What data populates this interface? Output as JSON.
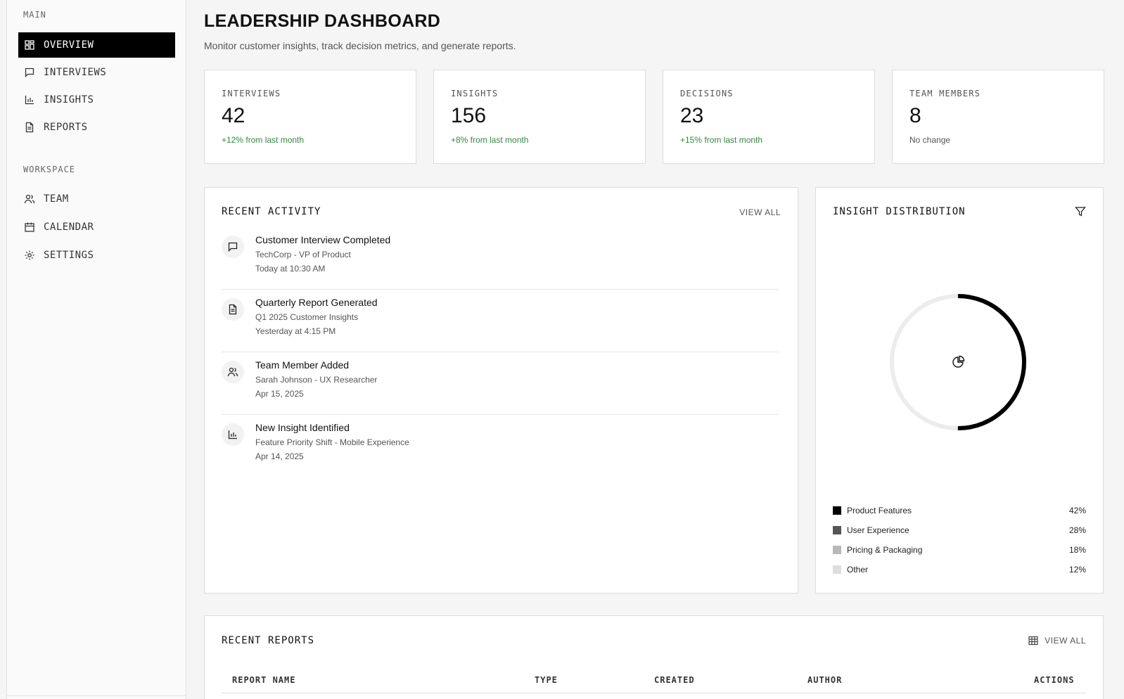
{
  "sidebar": {
    "main_label": "MAIN",
    "workspace_label": "WORKSPACE",
    "main_items": [
      {
        "label": "OVERVIEW",
        "icon": "dashboard-icon",
        "active": true
      },
      {
        "label": "INTERVIEWS",
        "icon": "message-square-icon"
      },
      {
        "label": "INSIGHTS",
        "icon": "bar-chart-icon"
      },
      {
        "label": "REPORTS",
        "icon": "file-text-icon"
      }
    ],
    "workspace_items": [
      {
        "label": "TEAM",
        "icon": "users-icon"
      },
      {
        "label": "CALENDAR",
        "icon": "calendar-icon"
      },
      {
        "label": "SETTINGS",
        "icon": "gear-icon"
      }
    ]
  },
  "header": {
    "title_light": "LEADERSHIP",
    "title_bold": "DASHBOARD",
    "subtitle": "Monitor customer insights, track decision metrics, and generate reports."
  },
  "stats": [
    {
      "label": "INTERVIEWS",
      "value": "42",
      "change": "+12% from last month",
      "positive": true
    },
    {
      "label": "INSIGHTS",
      "value": "156",
      "change": "+8% from last month",
      "positive": true
    },
    {
      "label": "DECISIONS",
      "value": "23",
      "change": "+15% from last month",
      "positive": true
    },
    {
      "label": "TEAM MEMBERS",
      "value": "8",
      "change": "No change",
      "positive": false
    }
  ],
  "activity": {
    "title": "RECENT ACTIVITY",
    "view_all": "VIEW ALL",
    "items": [
      {
        "title": "Customer Interview Completed",
        "subtitle": "TechCorp - VP of Product",
        "time": "Today at 10:30 AM",
        "icon": "message-square-icon"
      },
      {
        "title": "Quarterly Report Generated",
        "subtitle": "Q1 2025 Customer Insights",
        "time": "Yesterday at 4:15 PM",
        "icon": "file-text-icon"
      },
      {
        "title": "Team Member Added",
        "subtitle": "Sarah Johnson - UX Researcher",
        "time": "Apr 15, 2025",
        "icon": "users-icon"
      },
      {
        "title": "New Insight Identified",
        "subtitle": "Feature Priority Shift - Mobile Experience",
        "time": "Apr 14, 2025",
        "icon": "bar-chart-icon"
      }
    ]
  },
  "distribution": {
    "title": "INSIGHT DISTRIBUTION",
    "filter_icon": "filter-icon",
    "center_icon": "pie-chart-icon",
    "progress_fraction": 0.5,
    "legend": [
      {
        "label": "Product Features",
        "pct": "42%",
        "color": "#000000"
      },
      {
        "label": "User Experience",
        "pct": "28%",
        "color": "#555555"
      },
      {
        "label": "Pricing & Packaging",
        "pct": "18%",
        "color": "#b8b8b8"
      },
      {
        "label": "Other",
        "pct": "12%",
        "color": "#dddddd"
      }
    ]
  },
  "reports": {
    "title": "RECENT REPORTS",
    "view_all": "VIEW ALL",
    "columns": [
      "REPORT NAME",
      "TYPE",
      "CREATED",
      "AUTHOR",
      "ACTIONS"
    ]
  },
  "colors": {
    "positive": "#2e8b3e",
    "active_bg": "#000000"
  }
}
